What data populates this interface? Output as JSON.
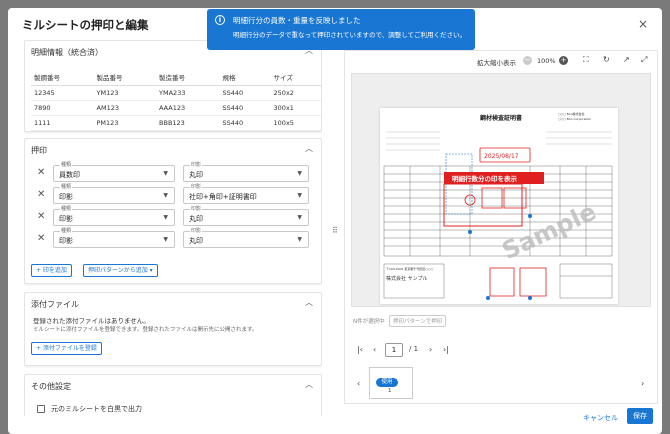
{
  "dialog": {
    "title": "ミルシートの押印と編集",
    "close": "×"
  },
  "toast": {
    "icon": "i",
    "line1": "明細行分の員数・重量を反映しました",
    "line2": "明細行分のデータで重なって押印されていますので、調整してご利用ください。"
  },
  "details": {
    "title": "明細情報（統合済）",
    "columns": [
      "製鋼番号",
      "製品番号",
      "製造番号",
      "規格",
      "サイズ"
    ],
    "rows": [
      [
        "12345",
        "YM123",
        "YMA233",
        "SS440",
        "250x2"
      ],
      [
        "7890",
        "AM123",
        "AAA123",
        "SS440",
        "300x1"
      ],
      [
        "1111",
        "PM123",
        "BBB123",
        "SS440",
        "100x5"
      ]
    ]
  },
  "stamps": {
    "title": "押印",
    "type_label": "種類",
    "stamp_label": "印影",
    "rows": [
      {
        "type": "員数印",
        "stamp": "丸印"
      },
      {
        "type": "印影",
        "stamp": "社印+角印+証明書印"
      },
      {
        "type": "印影",
        "stamp": "丸印"
      },
      {
        "type": "印影",
        "stamp": "丸印"
      }
    ],
    "add_button": "+ 印を追加",
    "pattern_button": "押印パターンから追加",
    "pattern_arrow": "▾"
  },
  "attachments": {
    "title": "添付ファイル",
    "empty": "登録された添付ファイルはありません。",
    "note": "ミルシートに添付ファイルを登録できます。登録されたファイルは開示先に公開されます。",
    "add_button": "+ 添付ファイルを登録"
  },
  "other": {
    "title": "その他設定",
    "checkbox_label": "元のミルシートを白黒で出力"
  },
  "preview": {
    "zoom_label": "拡大縮小表示",
    "zoom_value": "100%",
    "zoom_minus": "−",
    "zoom_plus": "+",
    "doc_title": "鋼材検査証明書",
    "doc_company": "○○○ Boo株式会社",
    "doc_company2": "○○○ Boo Corporation",
    "stamp_date": "2025/08/17",
    "callout": "明細行数分の印を表示",
    "watermark": "Sample",
    "doc_footer_company": "株式会社 サンプル",
    "doc_address": "〒100-0001 東京都千代田区○○○"
  },
  "selection": {
    "status": "N件が選択中",
    "pattern_button": "押印パターンで押印"
  },
  "pager": {
    "first": "|‹",
    "prev": "‹",
    "page": "1",
    "separator": "/ 1",
    "next": "›",
    "last": "›|"
  },
  "thumbs": {
    "badge": "使用",
    "num": "1",
    "left": "‹",
    "right": "›"
  },
  "footer": {
    "cancel": "キャンセル",
    "save": "保存"
  },
  "colors": {
    "primary": "#1976d2",
    "stamp_red": "#e02020"
  }
}
